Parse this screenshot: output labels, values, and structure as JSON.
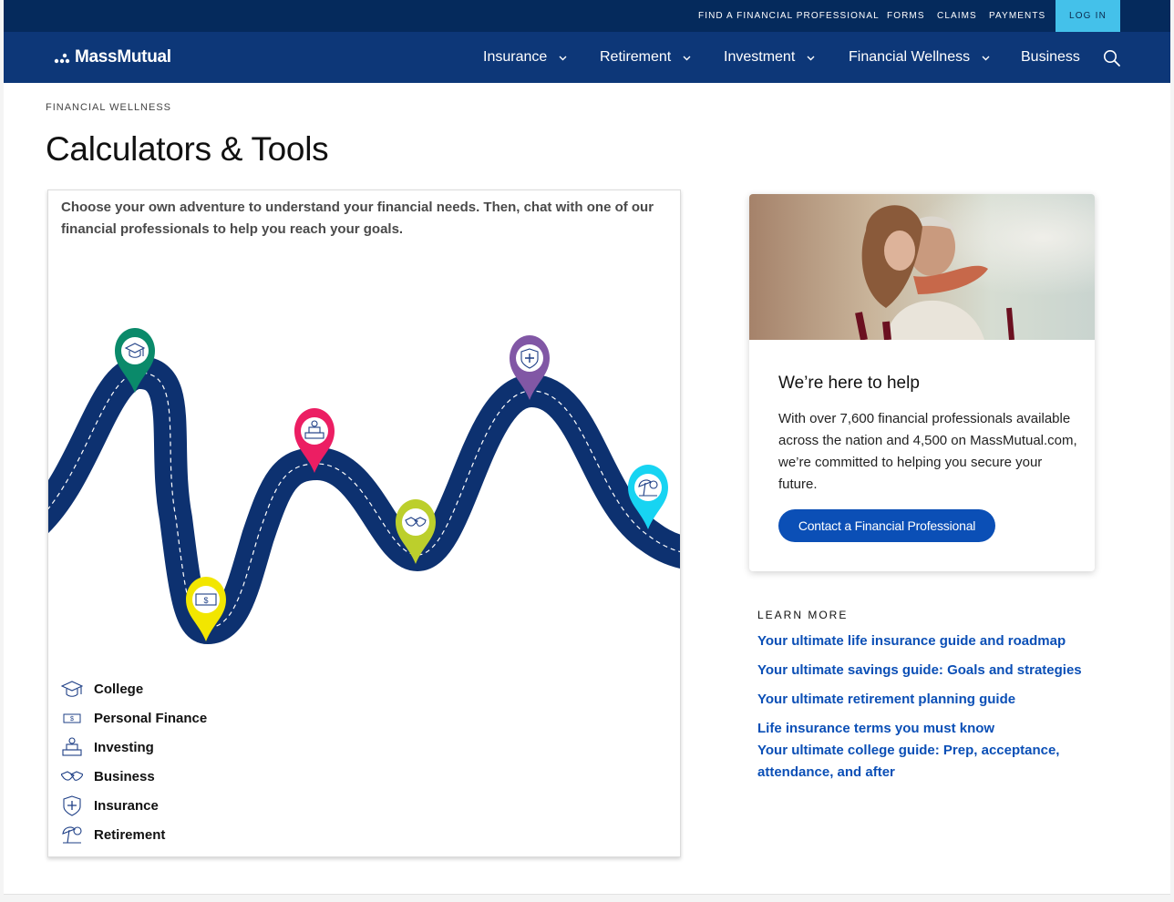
{
  "utility_nav": {
    "links": [
      "FIND A FINANCIAL PROFESSIONAL",
      "FORMS",
      "CLAIMS",
      "PAYMENTS"
    ],
    "login_label": "LOG IN"
  },
  "brand": {
    "name": "MassMutual"
  },
  "main_nav": {
    "items": [
      {
        "label": "Insurance",
        "has_dropdown": true
      },
      {
        "label": "Retirement",
        "has_dropdown": true
      },
      {
        "label": "Investment",
        "has_dropdown": true
      },
      {
        "label": "Financial Wellness",
        "has_dropdown": true
      },
      {
        "label": "Business",
        "has_dropdown": false
      }
    ],
    "search_icon": "search-icon"
  },
  "breadcrumb": "FINANCIAL WELLNESS",
  "page_title": "Calculators & Tools",
  "adventure": {
    "intro": "Choose your own adventure to understand your financial needs.  Then, chat with one of our financial professionals to help you reach your goals.",
    "pins": [
      {
        "name": "College",
        "icon": "graduation-cap-icon",
        "color": "#0a8a6a"
      },
      {
        "name": "Personal Finance",
        "icon": "dollar-bill-icon",
        "color": "#f2e600"
      },
      {
        "name": "Investing",
        "icon": "money-stack-icon",
        "color": "#ec1e63"
      },
      {
        "name": "Business",
        "icon": "handshake-icon",
        "color": "#bccf2c"
      },
      {
        "name": "Insurance",
        "icon": "shield-icon",
        "color": "#8157a5"
      },
      {
        "name": "Retirement",
        "icon": "beach-umbrella-icon",
        "color": "#17d4f2"
      }
    ],
    "legend": [
      {
        "label": "College",
        "icon": "graduation-cap-icon"
      },
      {
        "label": "Personal Finance",
        "icon": "dollar-bill-icon"
      },
      {
        "label": "Investing",
        "icon": "money-stack-icon"
      },
      {
        "label": "Business",
        "icon": "handshake-icon"
      },
      {
        "label": "Insurance",
        "icon": "shield-icon"
      },
      {
        "label": "Retirement",
        "icon": "beach-umbrella-icon"
      }
    ],
    "road_color": "#0d3170"
  },
  "help_card": {
    "title": "We’re here to help",
    "body": "With over 7,600 financial professionals available across the nation and 4,500 on MassMutual.com, we’re committed to helping you secure your future.",
    "button_label": "Contact a Financial Professional"
  },
  "learn_more": {
    "heading": "LEARN MORE",
    "links": [
      "Your ultimate life insurance guide and roadmap",
      "Your ultimate savings guide: Goals and strategies",
      "Your ultimate retirement planning guide",
      "Life insurance terms you must know",
      "Your ultimate college guide: Prep, acceptance, attendance, and after"
    ]
  },
  "colors": {
    "utility_bg": "#052a5c",
    "nav_bg": "#0d3778",
    "login_bg": "#44c1ea",
    "link": "#0b4fb6",
    "button_bg": "#0b4fb6"
  }
}
